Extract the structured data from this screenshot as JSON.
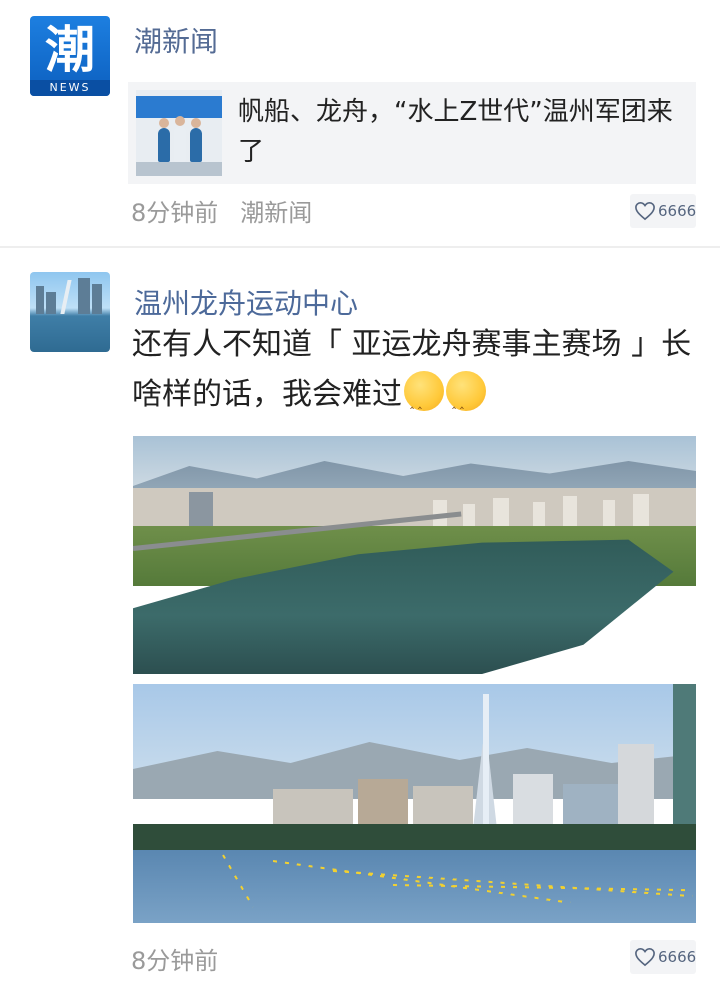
{
  "colors": {
    "author_name": "#546b94",
    "meta_text": "#9a9a9a",
    "share_card_bg": "#f3f4f6",
    "like_bg": "#f3f4f6"
  },
  "posts": [
    {
      "author": {
        "name": "潮新闻",
        "avatar_glyph": "潮",
        "avatar_badge": "NEWS"
      },
      "shared_article": {
        "title": "帆船、龙舟，“水上Z世代”温州军团来了"
      },
      "time": "8分钟前",
      "source": "潮新闻",
      "likes": {
        "icon": "heart-icon",
        "count": "6666"
      }
    },
    {
      "author": {
        "name": "温州龙舟运动中心"
      },
      "text": "还有人不知道「 亚运龙舟赛事主赛场 」长啥样的话，我会难过",
      "emojis": [
        "smiling-closed-eyes-emoji",
        "smiling-closed-eyes-emoji"
      ],
      "photos": [
        "aerial-lake-park-photo",
        "rowing-course-photo"
      ],
      "time": "8分钟前",
      "likes": {
        "icon": "heart-icon",
        "count": "6666"
      }
    }
  ]
}
